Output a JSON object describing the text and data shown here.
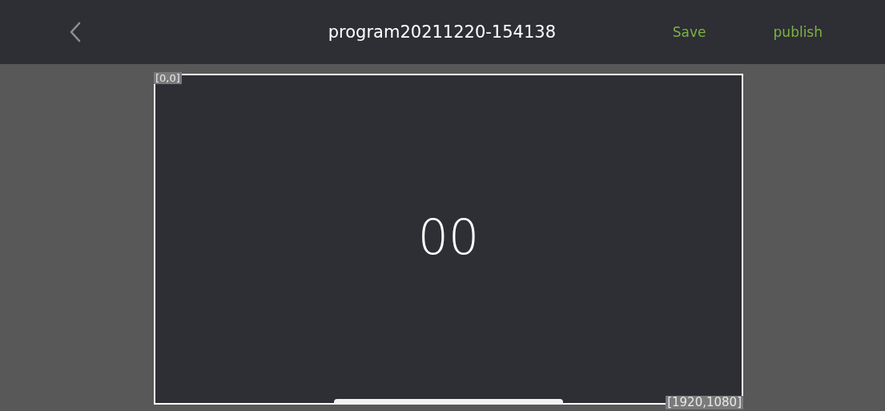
{
  "header": {
    "title": "program20211220-154138",
    "actions": [
      "Save",
      "publish"
    ]
  },
  "canvas": {
    "origin_label": "[0,0]",
    "end_label": "[1920,1080]",
    "content": "00"
  }
}
